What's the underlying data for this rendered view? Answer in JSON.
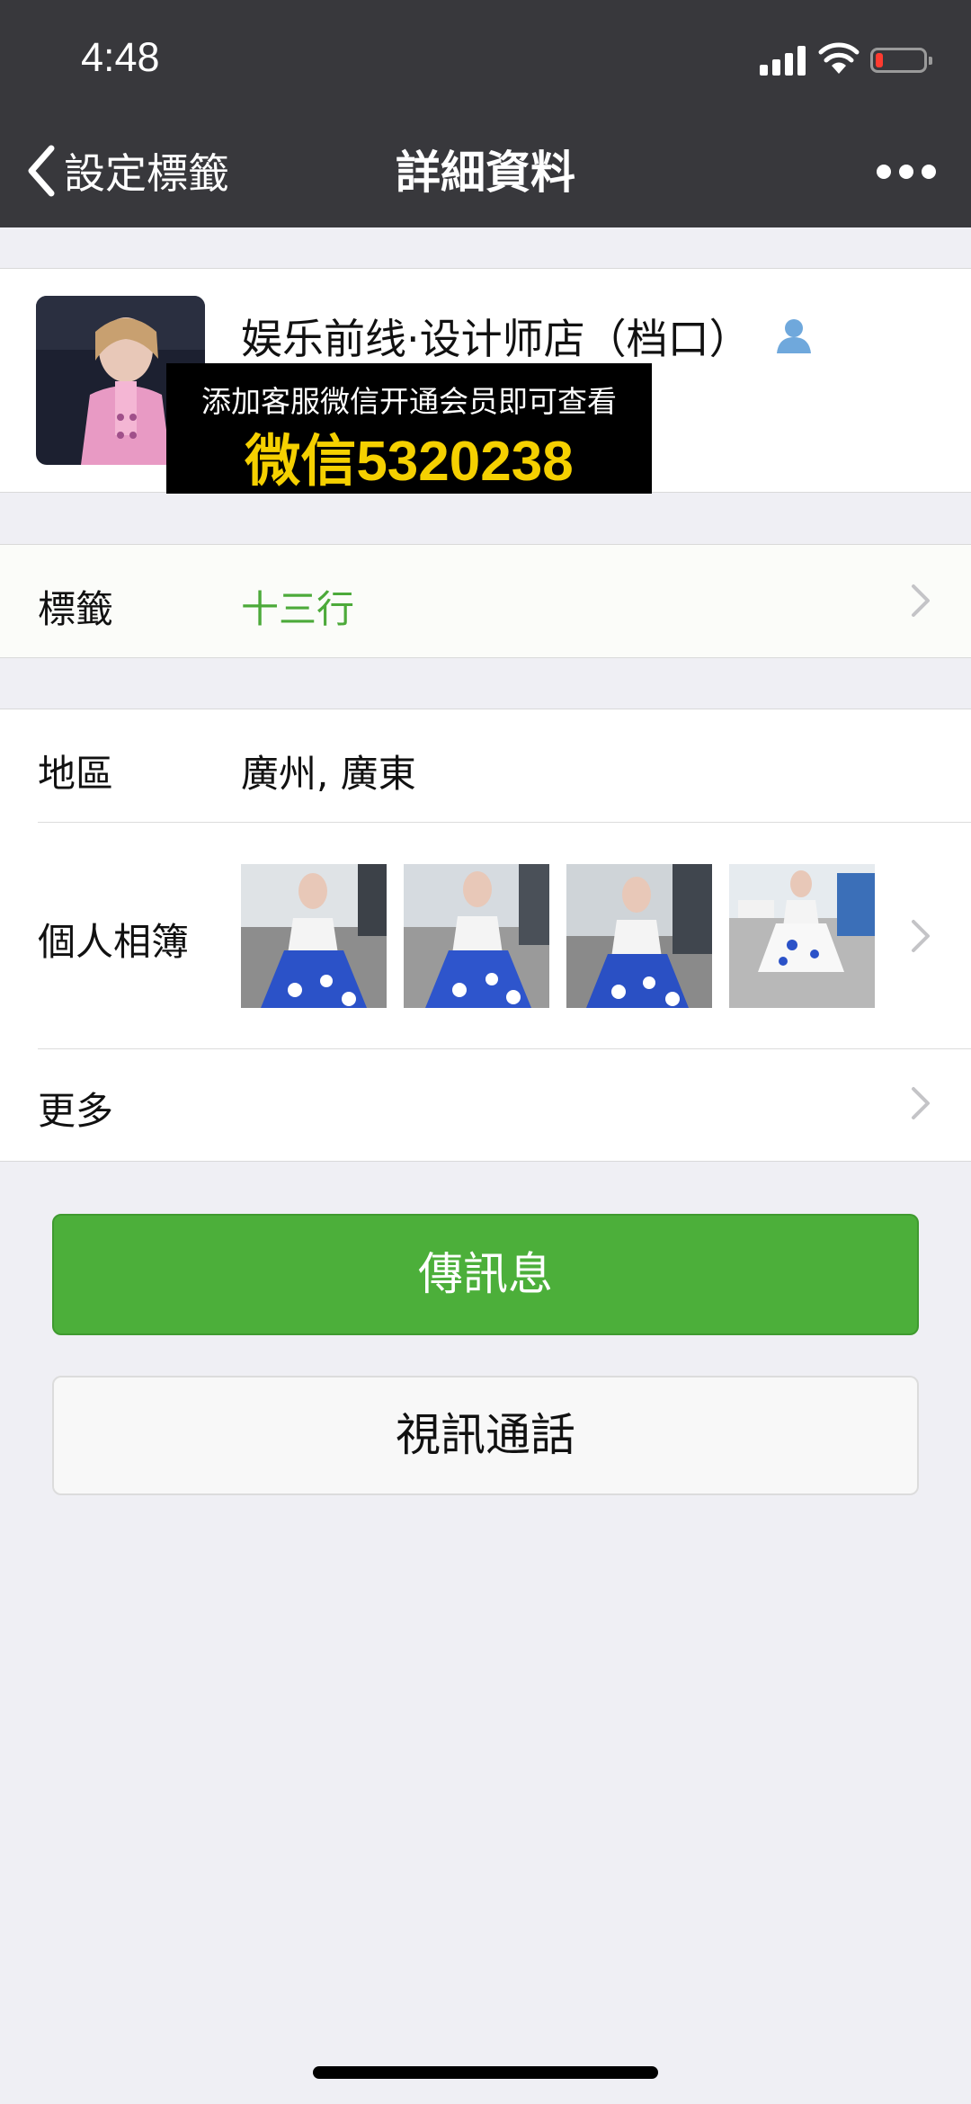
{
  "status_bar": {
    "time": "4:48",
    "battery_color": "#ff3b30"
  },
  "nav": {
    "back_label": "設定標籤",
    "title": "詳細資料"
  },
  "profile": {
    "name": "娱乐前线·设计师店（档口）",
    "ad_line1": "添加客服微信开通会员即可查看",
    "ad_line2": "微信5320238"
  },
  "tag_row": {
    "label": "標籤",
    "value": "十三行"
  },
  "region_row": {
    "label": "地區",
    "value": "廣州, 廣東"
  },
  "album_row": {
    "label": "個人相簿"
  },
  "more_row": {
    "label": "更多"
  },
  "actions": {
    "send_message": "傳訊息",
    "video_call": "視訊通話"
  },
  "colors": {
    "accent_green": "#4caf3a",
    "header_bg": "#38383c",
    "tag_green": "#4caa3a",
    "ad_yellow": "#f5d000"
  }
}
